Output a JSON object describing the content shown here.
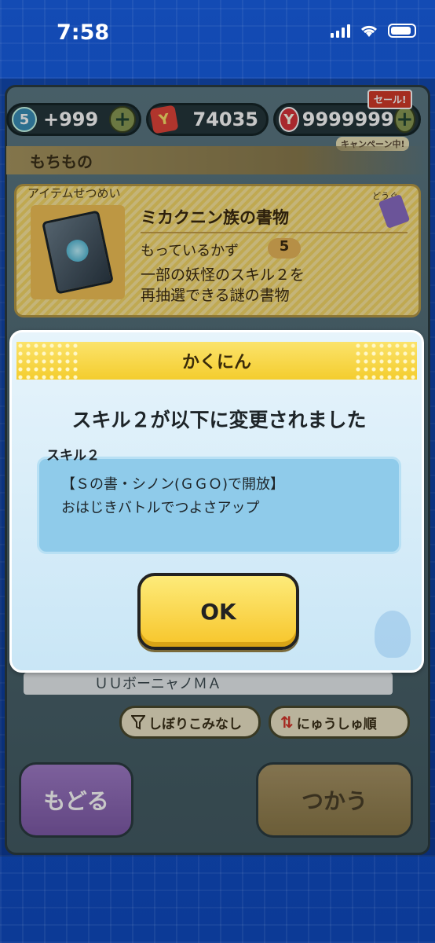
{
  "status_bar": {
    "time": "7:58"
  },
  "currency": {
    "level": "5",
    "medal_count": "+999",
    "coins": "74035",
    "gems": "9999999",
    "sale_tag": "セール!",
    "campaign_tag": "キャンペーン中!"
  },
  "section": {
    "title": "もちもの"
  },
  "item": {
    "card_label": "アイテムせつめい",
    "category": "どうぐ",
    "name": "ミカクニン族の書物",
    "count_label": "もっているかず",
    "count": "5",
    "description_line1": "一部の妖怪のスキル２を",
    "description_line2": "再抽選できる謎の書物"
  },
  "list": {
    "row_text": "ＵＵボーニャノＭＡ",
    "filter_label": "しぼりこみなし",
    "sort_label": "にゅうしゅ順"
  },
  "buttons": {
    "back": "もどる",
    "use": "つかう"
  },
  "dialog": {
    "title": "かくにん",
    "message": "スキル２が以下に変更されました",
    "skill_label": "スキル２",
    "skill_line1": "【Ｓの書・シノン(ＧＧＯ)で開放】",
    "skill_line2": "おはじきバトルでつよさアップ",
    "ok_label": "OK"
  }
}
